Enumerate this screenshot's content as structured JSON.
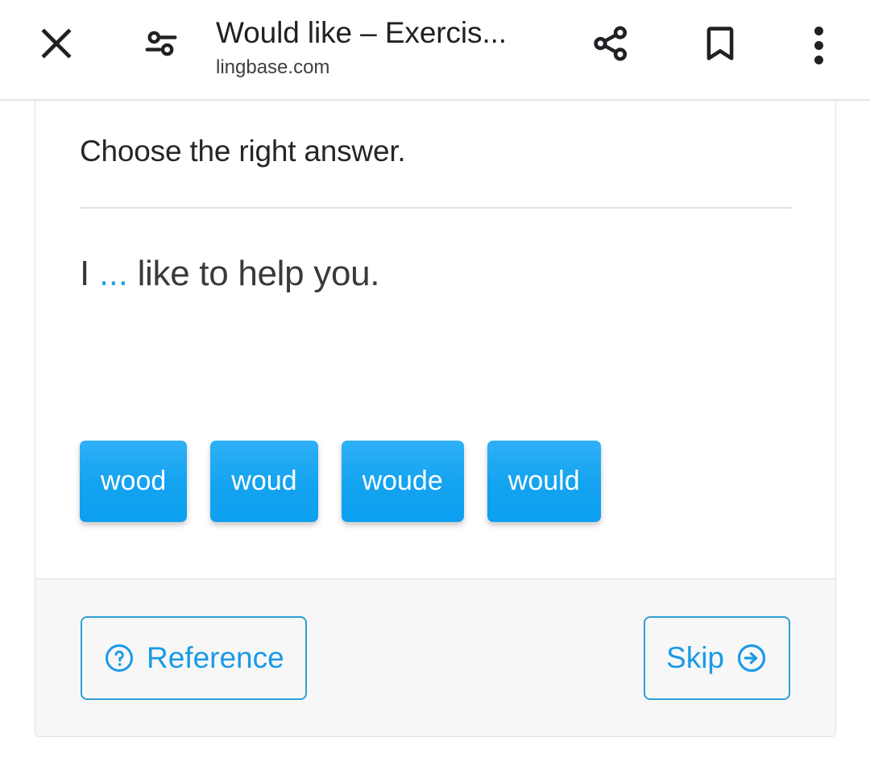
{
  "browser_toolbar": {
    "close_icon": "close-icon",
    "page_info_icon": "page-info-tune-icon",
    "title": "Would like – Exercis...",
    "origin": "lingbase.com",
    "share_icon": "share-icon",
    "bookmark_icon": "bookmark-icon",
    "menu_icon": "more-vertical-icon"
  },
  "exercise": {
    "prompt": "Choose the right answer.",
    "sentence_before": "I ",
    "blank": "...",
    "sentence_after": " like to help you.",
    "options": [
      {
        "label": "wood"
      },
      {
        "label": "woud"
      },
      {
        "label": "woude"
      },
      {
        "label": "would"
      }
    ]
  },
  "footer": {
    "reference_label": "Reference",
    "reference_icon": "help-circle-icon",
    "skip_label": "Skip",
    "skip_icon": "arrow-circle-right-icon"
  },
  "colors": {
    "accent_blue": "#13a3f0",
    "link_blue": "#1a9ae8",
    "outline_blue": "#2f9fd4",
    "blank_blue": "#2aa3e8",
    "text_dark": "#262626",
    "footer_bg": "#f7f7f7",
    "border_gray": "#e0e0e0"
  }
}
